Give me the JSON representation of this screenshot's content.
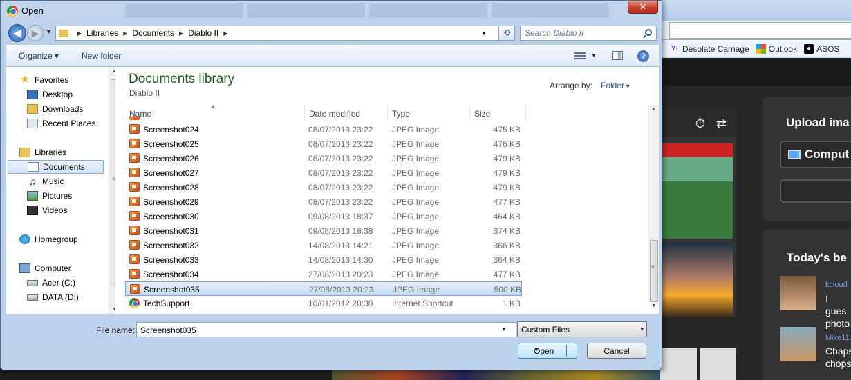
{
  "dialog": {
    "title": "Open",
    "close_label": "✕",
    "breadcrumb": [
      "Libraries",
      "Documents",
      "Diablo II"
    ],
    "search_placeholder": "Search Diablo II",
    "commands": {
      "organize": "Organize ▾",
      "new_folder": "New folder"
    },
    "library_title": "Documents library",
    "library_subtitle": "Diablo II",
    "arrange_label": "Arrange by:",
    "arrange_value": "Folder",
    "columns": {
      "name": "Name",
      "date": "Date modified",
      "type": "Type",
      "size": "Size"
    },
    "nav": {
      "favorites": "Favorites",
      "desktop": "Desktop",
      "downloads": "Downloads",
      "recent": "Recent Places",
      "libraries": "Libraries",
      "documents": "Documents",
      "music": "Music",
      "pictures": "Pictures",
      "videos": "Videos",
      "homegroup": "Homegroup",
      "computer": "Computer",
      "acer": "Acer (C:)",
      "data": "DATA (D:)"
    },
    "files": [
      {
        "name": "Screenshot024",
        "date": "08/07/2013 23:22",
        "type": "JPEG Image",
        "size": "475 KB"
      },
      {
        "name": "Screenshot025",
        "date": "08/07/2013 23:22",
        "type": "JPEG Image",
        "size": "476 KB"
      },
      {
        "name": "Screenshot026",
        "date": "08/07/2013 23:22",
        "type": "JPEG Image",
        "size": "479 KB"
      },
      {
        "name": "Screenshot027",
        "date": "08/07/2013 23:22",
        "type": "JPEG Image",
        "size": "479 KB"
      },
      {
        "name": "Screenshot028",
        "date": "08/07/2013 23:22",
        "type": "JPEG Image",
        "size": "479 KB"
      },
      {
        "name": "Screenshot029",
        "date": "08/07/2013 23:22",
        "type": "JPEG Image",
        "size": "477 KB"
      },
      {
        "name": "Screenshot030",
        "date": "09/08/2013 18:37",
        "type": "JPEG Image",
        "size": "464 KB"
      },
      {
        "name": "Screenshot031",
        "date": "09/08/2013 18:38",
        "type": "JPEG Image",
        "size": "374 KB"
      },
      {
        "name": "Screenshot032",
        "date": "14/08/2013 14:21",
        "type": "JPEG Image",
        "size": "366 KB"
      },
      {
        "name": "Screenshot033",
        "date": "14/08/2013 14:30",
        "type": "JPEG Image",
        "size": "364 KB"
      },
      {
        "name": "Screenshot034",
        "date": "27/08/2013 20:23",
        "type": "JPEG Image",
        "size": "477 KB"
      },
      {
        "name": "Screenshot035",
        "date": "27/08/2013 20:23",
        "type": "JPEG Image",
        "size": "500 KB"
      },
      {
        "name": "TechSupport",
        "date": "10/01/2012 20:30",
        "type": "Internet Shortcut",
        "size": "1 KB"
      }
    ],
    "selected_file": "Screenshot035",
    "file_name_label": "File name:",
    "file_name_value": "Screenshot035",
    "filter_value": "Custom Files",
    "open_label": "Open",
    "cancel_label": "Cancel"
  },
  "background": {
    "bookmarks": [
      "Desolate Carnage",
      "Outlook",
      "ASOS"
    ],
    "upload_title": "Upload ima",
    "computer_btn": "Comput",
    "today_title": "Today's be",
    "user1_name": "kcloud",
    "user1_text": "I gues photo",
    "user2_name": "Mike11",
    "user2_text": "Chaps chops"
  },
  "colors": {
    "library_title": "#1e5a1e",
    "selection": "#c7dcf5",
    "link": "#1e5aa8"
  }
}
